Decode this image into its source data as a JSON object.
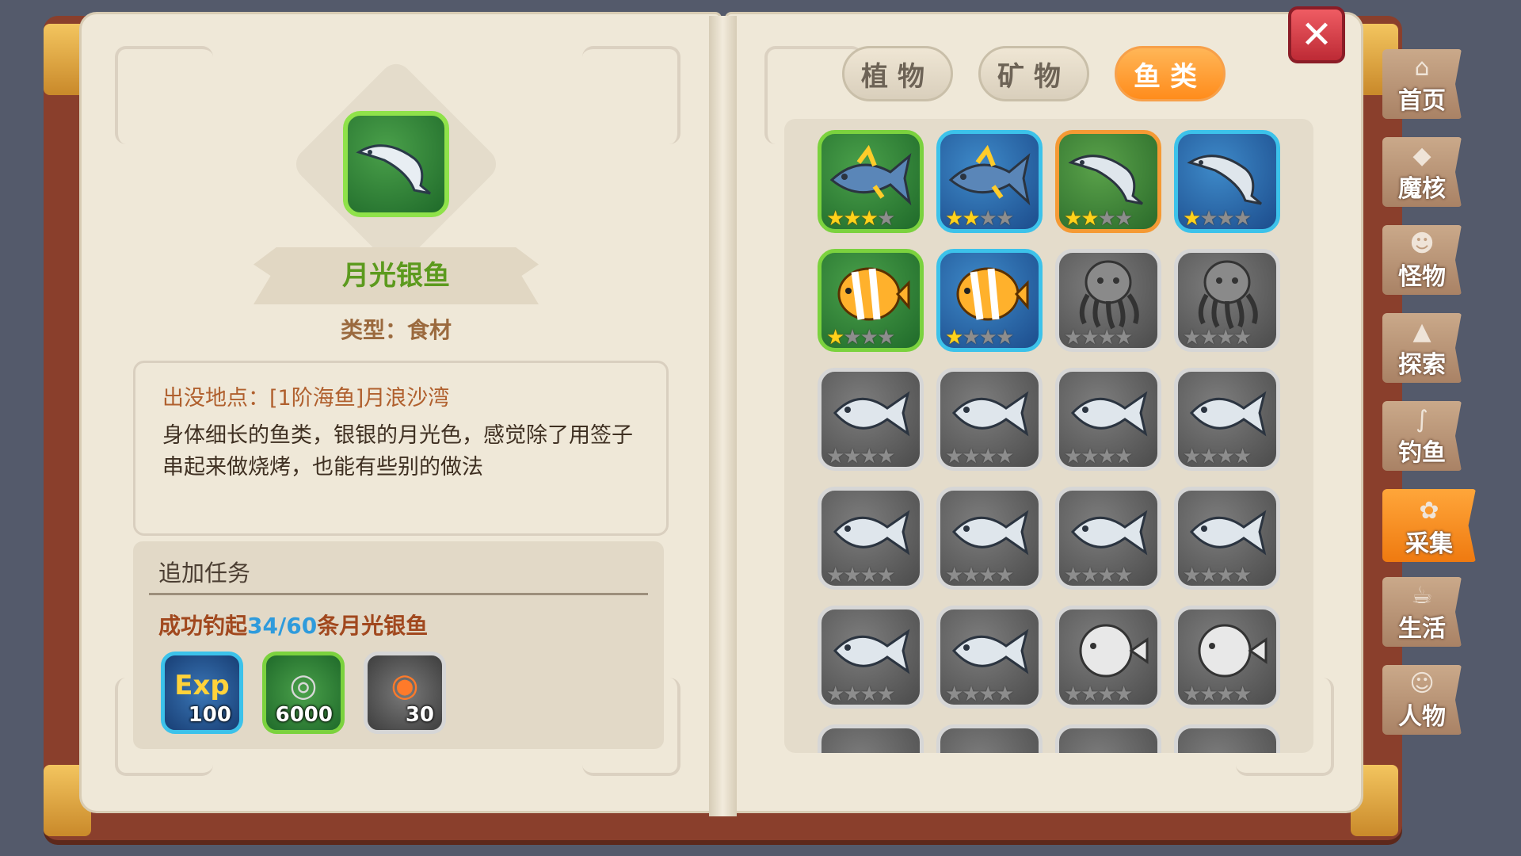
{
  "item": {
    "name": "月光银鱼",
    "type_label": "类型：食材",
    "location": "出没地点：[1阶海鱼]月浪沙湾",
    "description": "身体细长的鱼类，银银的月光色，感觉除了用签子串起来做烧烤，也能有些别的做法"
  },
  "task": {
    "title": "追加任务",
    "prefix": "成功钓起",
    "progress": "34/60",
    "suffix": "条月光银鱼",
    "rewards": [
      {
        "icon": "exp-icon",
        "qty": "100",
        "color": "#3cc2ea"
      },
      {
        "icon": "coins-icon",
        "qty": "6000",
        "color": "#7bd23e"
      },
      {
        "icon": "exp-fish-icon",
        "qty": "30",
        "color": "#d6d6d6"
      }
    ]
  },
  "tabs": [
    {
      "label": "植物",
      "active": false
    },
    {
      "label": "矿物",
      "active": false
    },
    {
      "label": "鱼类",
      "active": true
    }
  ],
  "close_label": "✕",
  "grid": [
    {
      "icon": "tuna-icon",
      "rarity": "green",
      "stars": 3
    },
    {
      "icon": "tuna-icon",
      "rarity": "blue",
      "stars": 2
    },
    {
      "icon": "silverfish-icon",
      "rarity": "orange",
      "stars": 2
    },
    {
      "icon": "silverfish-icon",
      "rarity": "blue",
      "stars": 1
    },
    {
      "icon": "butterflyfish-icon",
      "rarity": "green",
      "stars": 1
    },
    {
      "icon": "butterflyfish-icon",
      "rarity": "blue",
      "stars": 1
    },
    {
      "icon": "octopus-icon",
      "rarity": "gray",
      "stars": 0
    },
    {
      "icon": "octopus-icon",
      "rarity": "gray",
      "stars": 0
    },
    {
      "icon": "fish-icon",
      "rarity": "gray",
      "stars": 0
    },
    {
      "icon": "fish-icon",
      "rarity": "gray",
      "stars": 0
    },
    {
      "icon": "perch-icon",
      "rarity": "gray",
      "stars": 0
    },
    {
      "icon": "perch-icon",
      "rarity": "gray",
      "stars": 0
    },
    {
      "icon": "carp-icon",
      "rarity": "gray",
      "stars": 0
    },
    {
      "icon": "carp-icon",
      "rarity": "gray",
      "stars": 0
    },
    {
      "icon": "bass-icon",
      "rarity": "gray",
      "stars": 0
    },
    {
      "icon": "bass-icon",
      "rarity": "gray",
      "stars": 0
    },
    {
      "icon": "mackerel-icon",
      "rarity": "gray",
      "stars": 0
    },
    {
      "icon": "mackerel-icon",
      "rarity": "gray",
      "stars": 0
    },
    {
      "icon": "pufferfish-icon",
      "rarity": "gray",
      "stars": 0
    },
    {
      "icon": "pufferfish-icon",
      "rarity": "gray",
      "stars": 0
    }
  ],
  "side_tabs": [
    {
      "label": "首页",
      "icon": "home-icon",
      "glyph": "⌂",
      "active": false
    },
    {
      "label": "魔核",
      "icon": "core-icon",
      "glyph": "◆",
      "active": false
    },
    {
      "label": "怪物",
      "icon": "monster-icon",
      "glyph": "☻",
      "active": false
    },
    {
      "label": "探索",
      "icon": "explore-icon",
      "glyph": "▲",
      "active": false
    },
    {
      "label": "钓鱼",
      "icon": "fishing-icon",
      "glyph": "∫",
      "active": false
    },
    {
      "label": "采集",
      "icon": "gather-icon",
      "glyph": "✿",
      "active": true
    },
    {
      "label": "生活",
      "icon": "life-icon",
      "glyph": "☕",
      "active": false
    },
    {
      "label": "人物",
      "icon": "character-icon",
      "glyph": "☺",
      "active": false
    }
  ]
}
